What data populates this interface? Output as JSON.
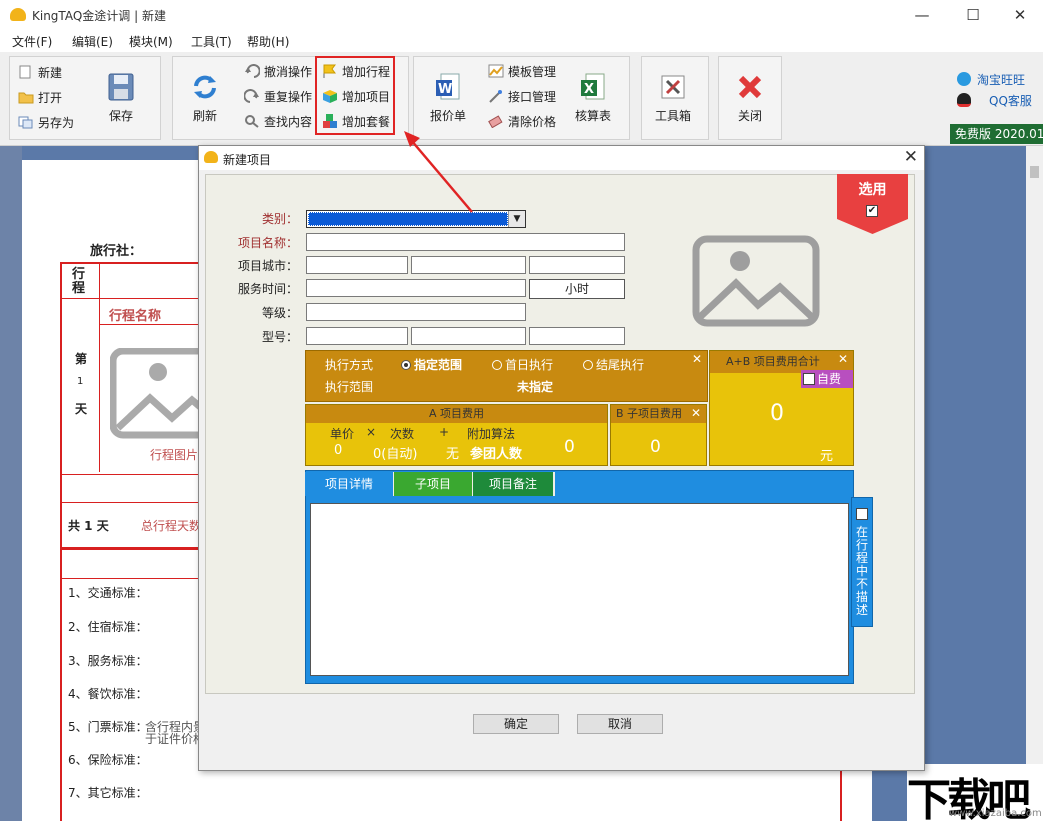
{
  "window": {
    "title": "KingTAQ金途计调 | 新建",
    "minimize": "—",
    "maximize": "☐",
    "close": "✕"
  },
  "menu": [
    "文件(F)",
    "编辑(E)",
    "模块(M)",
    "工具(T)",
    "帮助(H)"
  ],
  "toolbar": {
    "new": "新建",
    "open": "打开",
    "save_as": "另存为",
    "save": "保存",
    "refresh": "刷新",
    "undo": "撤消操作",
    "redo": "重复操作",
    "find": "查找内容",
    "add_itinerary": "增加行程",
    "add_item": "增加项目",
    "add_package": "增加套餐",
    "quote": "报价单",
    "template_mgmt": "模板管理",
    "interface_mgmt": "接口管理",
    "clear_price": "清除价格",
    "check_sheet": "核算表",
    "toolbox": "工具箱",
    "close": "关闭",
    "taobao": "淘宝旺旺",
    "qq": "QQ客服",
    "version": "免费版 2020.01"
  },
  "document": {
    "agency_label": "旅行社：",
    "itinerary_col": "行程",
    "itinerary_name": "行程名称",
    "day_label": "第",
    "day_num": "1",
    "day_suffix": "天",
    "itinerary_image": "行程图片",
    "total_days_prefix": "共 1 天",
    "total_days_label": "总行程天数",
    "standards": [
      "1、交通标准：",
      "2、住宿标准：",
      "3、服务标准：",
      "4、餐饮标准：",
      "5、门票标准：",
      "6、保险标准：",
      "7、其它标准："
    ],
    "ticket_note_1": "含行程内景",
    "ticket_note_2": "于证件价格"
  },
  "dialog": {
    "title": "新建项目",
    "close": "✕",
    "labels": {
      "category": "类别：",
      "item_name": "项目名称：",
      "item_city": "项目城市：",
      "service_time": "服务时间：",
      "grade": "等级：",
      "model": "型号："
    },
    "hours_unit": "小时",
    "select_badge": "选用",
    "select_checked": "✔",
    "exec": {
      "mode_label": "执行方式",
      "opt_range": "指定范围",
      "opt_first": "首日执行",
      "opt_last": "结尾执行",
      "range_label": "执行范围",
      "range_value": "未指定"
    },
    "fee_a": {
      "header": "A 项目费用",
      "unit_price": "单价",
      "times_sign": "×",
      "count": "次数",
      "plus_sign": "+",
      "extra": "附加算法",
      "unit_price_value": "0",
      "count_value": "0(自动)",
      "extra_value": "无",
      "group_size": "参团人数",
      "total": "0"
    },
    "fee_b": {
      "header": "B 子项目费用",
      "total": "0"
    },
    "fee_total": {
      "header": "A+B 项目费用合计",
      "self_pay": "自费",
      "value": "0",
      "unit": "元"
    },
    "tabs": [
      "项目详情",
      "子项目",
      "项目备注"
    ],
    "side_label": "在行程中不描述",
    "ok": "确定",
    "cancel": "取消"
  },
  "watermark": {
    "logo": "下载吧",
    "url": "www.xiazaiba.com"
  },
  "colors": {
    "accent_red": "#e02424",
    "fee_orange": "#c88a10",
    "fee_yellow": "#e8c30a",
    "tab_blue": "#1f8de0",
    "tab_green": "#3aa830",
    "tab_dark_green": "#1e8a3a",
    "badge_red": "#e84040",
    "self_pay_purple": "#b84fbf"
  }
}
